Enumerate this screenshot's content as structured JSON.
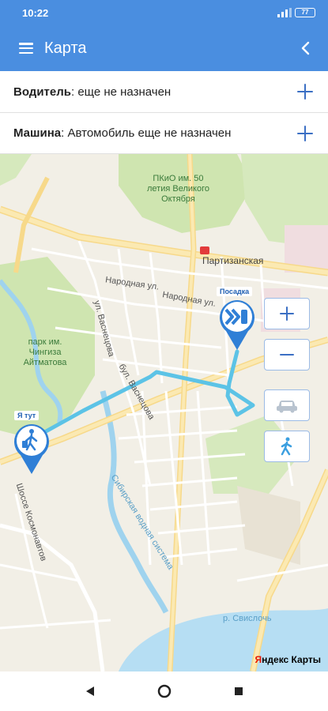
{
  "status_bar": {
    "time": "10:22",
    "battery": "77"
  },
  "app_bar": {
    "title": "Карта"
  },
  "driver_row": {
    "label": "Водитель",
    "value": ": еще не назначен"
  },
  "car_row": {
    "label": "Машина",
    "value": ": Автомобиль еще не назначен"
  },
  "map": {
    "labels": {
      "park_top": "ПКиО им. 50\nлетия Великого\nОктября",
      "metro": "Партизанская",
      "park_left": "парк им.\nЧингиза\nАйтматова",
      "street_1": "Народная ул.",
      "street_2": "Народная ул.",
      "street_3": "ул. Васнецова",
      "street_4": "бул. Васнецова",
      "street_5": "Шоссе Космонавтов",
      "street_6": "Сибирская водная система",
      "street_7": "р. Свислочь"
    },
    "pickup_tag": "Посадка",
    "me_tag": "Я тут",
    "zoom_in": "+",
    "zoom_out": "−",
    "attribution_y": "Я",
    "attribution_rest": "ндекс Карты"
  },
  "colors": {
    "primary": "#4a8ee0",
    "route": "#5cc3e6",
    "pin": "#2f7fd6"
  }
}
